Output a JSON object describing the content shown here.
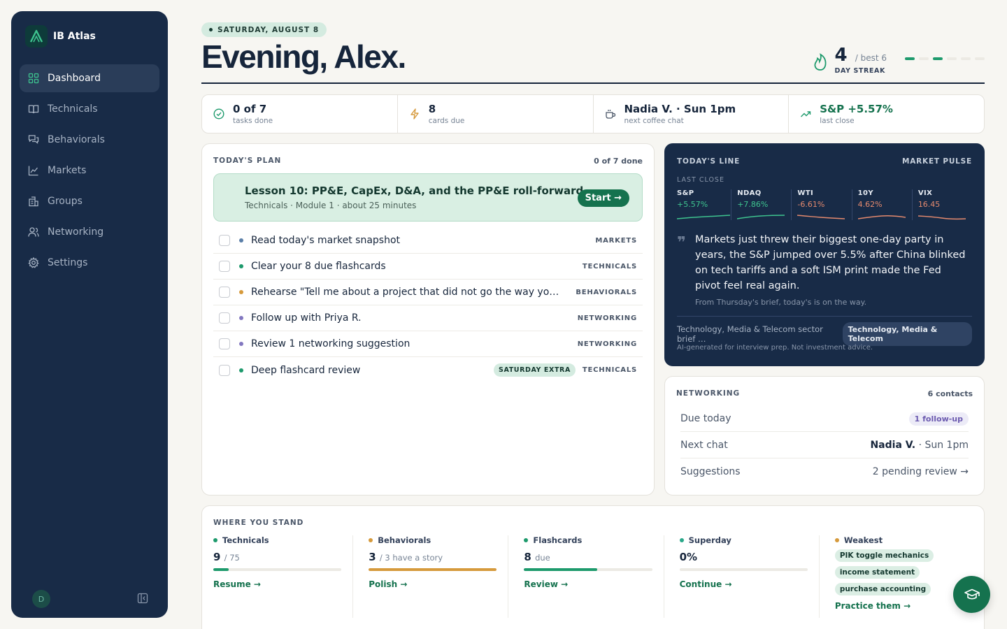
{
  "brand": {
    "name": "IB Atlas"
  },
  "sidebar": {
    "items": [
      {
        "label": "Dashboard",
        "icon": "dashboard-icon",
        "active": true
      },
      {
        "label": "Technicals",
        "icon": "book-icon"
      },
      {
        "label": "Behaviorals",
        "icon": "chat-icon"
      },
      {
        "label": "Markets",
        "icon": "chart-icon"
      },
      {
        "label": "Groups",
        "icon": "building-icon"
      },
      {
        "label": "Networking",
        "icon": "people-icon"
      },
      {
        "label": "Settings",
        "icon": "gear-icon"
      }
    ],
    "avatar_initial": "D"
  },
  "header": {
    "date": "SATURDAY, AUGUST 8",
    "greeting": "Evening, Alex.",
    "streak": {
      "value": "4",
      "best": "/ best 6",
      "label": "DAY STREAK",
      "bars_on": [
        true,
        false,
        true,
        false,
        false,
        false
      ]
    }
  },
  "stats": [
    {
      "main": "0 of 7",
      "sub": "tasks done",
      "icon": "check-circle-icon"
    },
    {
      "main": "8",
      "sub": "cards due",
      "icon": "bolt-icon"
    },
    {
      "main": "Nadia V. · Sun 1pm",
      "sub": "next coffee chat",
      "icon": "coffee-icon"
    },
    {
      "main": "S&P +5.57%",
      "sub": "last close",
      "icon": "trend-up-icon"
    }
  ],
  "plan": {
    "label": "TODAY'S PLAN",
    "count": "0 of 7 done",
    "lesson": {
      "title": "Lesson 10: PP&E, CapEx, D&A, and the PP&E roll-forward",
      "meta": "Technicals · Module 1 · about 25 minutes",
      "start": "Start →"
    },
    "tasks": [
      {
        "text": "Read today's market snapshot",
        "tag": "MARKETS",
        "dot": "#5b7fa8"
      },
      {
        "text": "Clear your 8 due flashcards",
        "tag": "TECHNICALS",
        "dot": "#1d9a6c"
      },
      {
        "text": "Rehearse \"Tell me about a project that did not go the way you planned\"",
        "tag": "BEHAVIORALS",
        "dot": "#d69a3c"
      },
      {
        "text": "Follow up with Priya R.",
        "tag": "NETWORKING",
        "dot": "#8277c0"
      },
      {
        "text": "Review 1 networking suggestion",
        "tag": "NETWORKING",
        "dot": "#8277c0"
      },
      {
        "text": "Deep flashcard review",
        "tag": "TECHNICALS",
        "dot": "#1d9a6c",
        "extra": "SATURDAY EXTRA"
      }
    ]
  },
  "line": {
    "label": "TODAY'S LINE",
    "right": "MARKET PULSE",
    "last_close": "LAST CLOSE",
    "tickers": [
      {
        "name": "S&P",
        "value": "+5.57%",
        "color": "#3ec48f"
      },
      {
        "name": "NDAQ",
        "value": "+7.86%",
        "color": "#3ec48f"
      },
      {
        "name": "WTI",
        "value": "-6.61%",
        "color": "#e58a6e"
      },
      {
        "name": "10Y",
        "value": "4.62%",
        "color": "#e58a6e"
      },
      {
        "name": "VIX",
        "value": "16.45",
        "color": "#e58a6e"
      }
    ],
    "quote": "Markets just threw their biggest one-day party in years, the S&P jumped over 5.5% after China blinked on tech tariffs and a soft ISM print made the Fed pivot feel real again.",
    "quote_foot": "From Thursday's brief, today's is on the way.",
    "brief_text": "Technology, Media & Telecom sector brief …",
    "brief_pill": "Technology, Media & Telecom",
    "disclaimer": "AI-generated for interview prep. Not investment advice."
  },
  "networking": {
    "label": "NETWORKING",
    "contacts": "6 contacts",
    "due_label": "Due today",
    "due_value": "1 follow-up",
    "next_label": "Next chat",
    "next_name": "Nadia V.",
    "next_time": "· Sun 1pm",
    "sugg_label": "Suggestions",
    "sugg_value": "2 pending review →"
  },
  "stand": {
    "label": "WHERE YOU STAND",
    "technicals": {
      "title": "Technicals",
      "value": "9",
      "suffix": "/ 75",
      "progress": 0.12,
      "link": "Resume →",
      "color": "#1d9a6c"
    },
    "behaviorals": {
      "title": "Behaviorals",
      "value": "3",
      "suffix": "/ 3 have a story",
      "progress": 1.0,
      "link": "Polish →",
      "color": "#d69a3c"
    },
    "flashcards": {
      "title": "Flashcards",
      "value": "8",
      "suffix": "due",
      "progress": 0.57,
      "link": "Review →",
      "color": "#1d9a6c"
    },
    "superday": {
      "title": "Superday",
      "value": "0%",
      "suffix": "",
      "progress": 0,
      "link": "Continue →",
      "color": "#2aa88a"
    },
    "weakest": {
      "title": "Weakest",
      "tags": [
        "PIK toggle mechanics",
        "income statement",
        "purchase accounting"
      ],
      "link": "Practice them →",
      "color": "#d69a3c"
    }
  }
}
